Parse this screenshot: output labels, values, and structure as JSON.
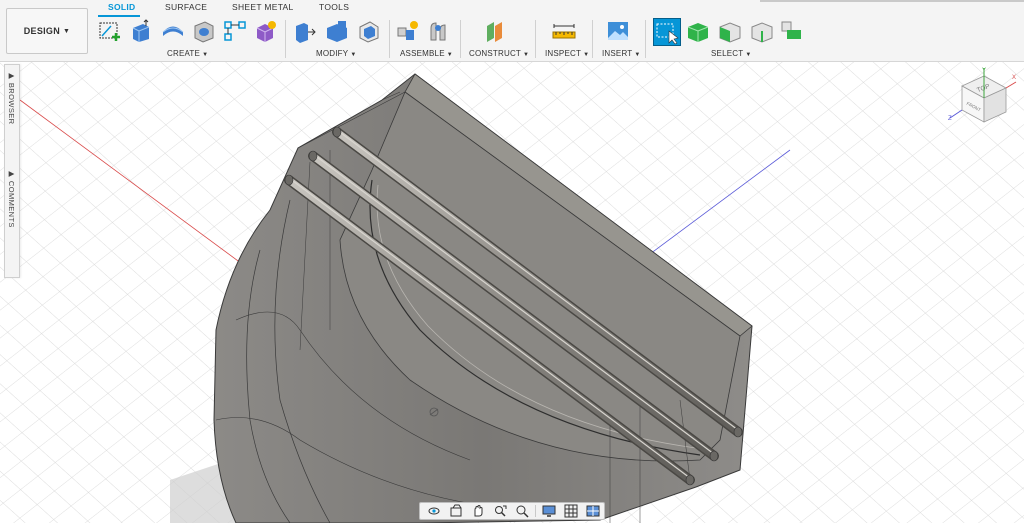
{
  "workspace": {
    "label": "DESIGN"
  },
  "tabs": [
    {
      "label": "SOLID",
      "active": true
    },
    {
      "label": "SURFACE",
      "active": false
    },
    {
      "label": "SHEET METAL",
      "active": false
    },
    {
      "label": "TOOLS",
      "active": false
    }
  ],
  "groups": {
    "create": "CREATE",
    "modify": "MODIFY",
    "assemble": "ASSEMBLE",
    "construct": "CONSTRUCT",
    "inspect": "INSPECT",
    "insert": "INSERT",
    "select": "SELECT"
  },
  "tools": {
    "create": [
      "create-sketch-icon",
      "extrude-icon",
      "revolve-icon",
      "hole-icon",
      "pattern-icon",
      "create-form-icon"
    ],
    "modify": [
      "press-pull-icon",
      "fillet-icon",
      "shell-icon"
    ],
    "assemble": [
      "new-component-icon",
      "joint-icon"
    ],
    "construct": [
      "offset-plane-icon"
    ],
    "inspect": [
      "measure-icon"
    ],
    "insert": [
      "insert-image-icon"
    ],
    "select": [
      "window-select-icon",
      "select-body-icon",
      "select-face-icon",
      "select-edge-icon",
      "select-component-icon"
    ]
  },
  "browser_panel": {
    "browser": "BROWSER",
    "comments": "COMMENTS"
  },
  "viewcube": {
    "top": "TOP",
    "front": "FRONT",
    "axis_x": "X",
    "axis_y": "Y",
    "axis_z": "Z"
  },
  "navbar": [
    "orbit-icon",
    "look-at-icon",
    "pan-icon",
    "zoom-window-icon",
    "zoom-icon",
    "display-settings-icon",
    "grid-settings-icon",
    "viewports-icon"
  ],
  "colors": {
    "accent": "#0696d7",
    "body_gray": "#7d7b78",
    "rod": "#9c9994",
    "x_axis": "#d94a4a",
    "y_axis": "#5a5ad8"
  }
}
